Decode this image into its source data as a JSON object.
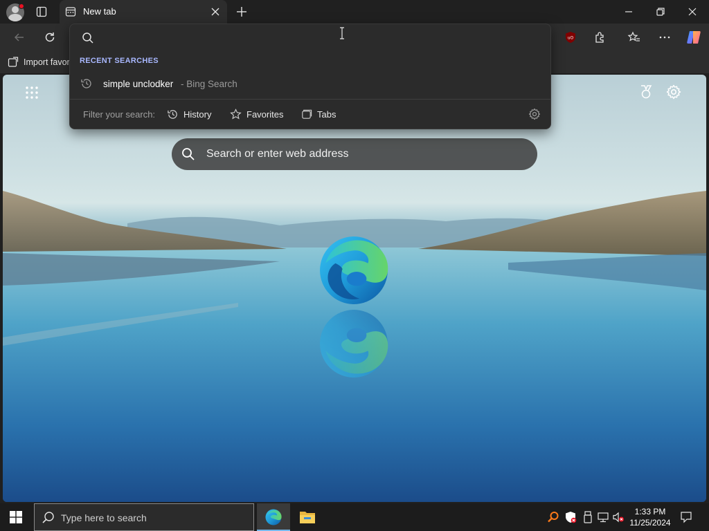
{
  "tab": {
    "title": "New tab"
  },
  "favorites_bar": {
    "import_label": "Import favor"
  },
  "omnibox": {
    "value": "",
    "recent_header": "RECENT SEARCHES",
    "suggestion": {
      "query": "simple unclodker",
      "source": "- Bing Search"
    },
    "filter_label": "Filter your search:",
    "filters": [
      {
        "label": "History",
        "icon": "history-icon"
      },
      {
        "label": "Favorites",
        "icon": "star-icon"
      },
      {
        "label": "Tabs",
        "icon": "tabs-icon"
      }
    ]
  },
  "ntp": {
    "search_placeholder": "Search or enter web address"
  },
  "taskbar": {
    "search_placeholder": "Type here to search",
    "time": "1:33 PM",
    "date": "11/25/2024"
  },
  "colors": {
    "accent": "#76b9ed",
    "recent_header": "#a9b8ff",
    "badge": "#e81123"
  }
}
